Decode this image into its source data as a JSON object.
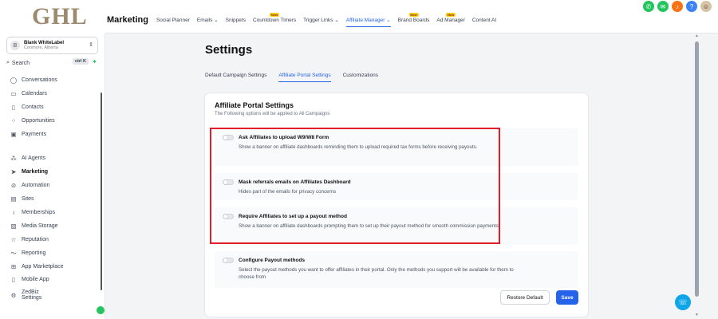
{
  "brand": {
    "logo": "GHL"
  },
  "account": {
    "initial": "B",
    "name": "Blank WhiteLabel",
    "location": "Conmore, Alberta"
  },
  "search": {
    "label": "Search",
    "shortcut": "ctrl K"
  },
  "sidebar": {
    "items": [
      {
        "label": "Conversations",
        "icon": "chat-icon"
      },
      {
        "label": "Calendars",
        "icon": "calendar-icon"
      },
      {
        "label": "Contacts",
        "icon": "contacts-icon"
      },
      {
        "label": "Opportunities",
        "icon": "opportunities-icon"
      },
      {
        "label": "Payments",
        "icon": "payments-icon"
      },
      {
        "label": "AI Agents",
        "icon": "sparkle-icon"
      },
      {
        "label": "Marketing",
        "icon": "send-icon",
        "active": true
      },
      {
        "label": "Automation",
        "icon": "automation-icon"
      },
      {
        "label": "Sites",
        "icon": "sites-icon"
      },
      {
        "label": "Memberships",
        "icon": "memberships-icon"
      },
      {
        "label": "Media Storage",
        "icon": "media-icon"
      },
      {
        "label": "Reputation",
        "icon": "star-icon"
      },
      {
        "label": "Reporting",
        "icon": "reporting-icon"
      },
      {
        "label": "App Marketplace",
        "icon": "apps-icon"
      },
      {
        "label": "Mobile App",
        "icon": "mobile-icon"
      },
      {
        "label": "ZedBiz Settings",
        "icon": "settings-icon"
      }
    ]
  },
  "topnav": {
    "title": "Marketing",
    "items": [
      {
        "label": "Social Planner"
      },
      {
        "label": "Emails ⌄"
      },
      {
        "label": "Snippets"
      },
      {
        "label": "Countdown Timers",
        "badge": "New"
      },
      {
        "label": "Trigger Links ⌄"
      },
      {
        "label": "Affiliate Manager ⌄",
        "active": true
      },
      {
        "label": "Brand Boards",
        "badge": "New"
      },
      {
        "label": "Ad Manager",
        "badge": "New"
      },
      {
        "label": "Content AI"
      }
    ]
  },
  "page": {
    "title": "Settings",
    "tabs": [
      {
        "label": "Default Campaign Settings"
      },
      {
        "label": "Affiliate Portal Settings",
        "active": true
      },
      {
        "label": "Customizations"
      }
    ]
  },
  "card": {
    "title": "Affiliate Portal Settings",
    "subtitle": "The Following options will be applied to All Campaigns",
    "options": [
      {
        "title": "Ask Affiliates to upload W9/W8 Form",
        "desc": "Show a banner on affiliate dashboards reminding them to upload required tax forms before receiving payouts.",
        "enabled": false
      },
      {
        "title": "Mask referrals emails on Affiliates Dashboard",
        "desc": "Hides part of the emails for privacy concerns",
        "enabled": false
      },
      {
        "title": "Require Affiliates to set up a payout method",
        "desc": "Show a banner on affiliate dashboards prompting them to set up their payout method for smooth commission payments.",
        "enabled": false
      },
      {
        "title": "Configure Payout methods",
        "desc": "Select the payout methods you want to offer affiliates in their portal. Only the methods you support will be available for them to choose from",
        "enabled": false
      }
    ],
    "restore_label": "Restore Default",
    "save_label": "Save"
  },
  "colors": {
    "accent": "#2563eb",
    "highlight": "#e11d27",
    "brand": "#9b8a6e"
  }
}
